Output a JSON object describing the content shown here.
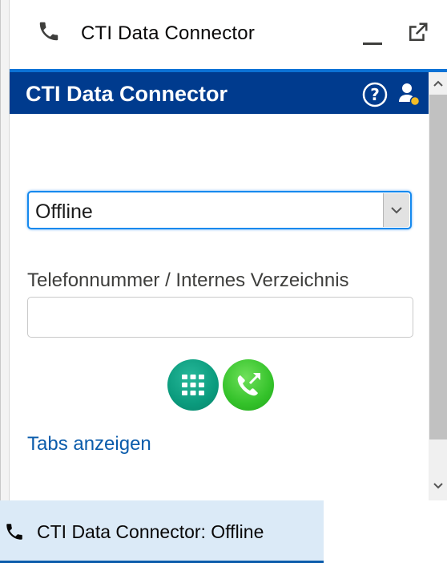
{
  "window": {
    "title": "CTI Data Connector",
    "icons": {
      "phone": "phone-icon",
      "minimize": "minimize-icon",
      "popout": "popout-icon"
    }
  },
  "softphone": {
    "header_title": "CTI Data Connector",
    "help_icon": "help-icon",
    "agent_icon": "agent-status-icon",
    "header_color": "#003b8e",
    "status_select": {
      "value": "Offline",
      "options": [
        "Offline"
      ]
    },
    "phone_field": {
      "label": "Telefonnummer / Internes Verzeichnis",
      "value": "",
      "placeholder": ""
    },
    "buttons": {
      "dialpad": "dialpad-icon",
      "call": "call-icon"
    },
    "tabs_link": "Tabs anzeigen"
  },
  "utility_bar": {
    "tab_label": "CTI Data Connector: Offline",
    "tab_color": "#dbeaf7"
  }
}
